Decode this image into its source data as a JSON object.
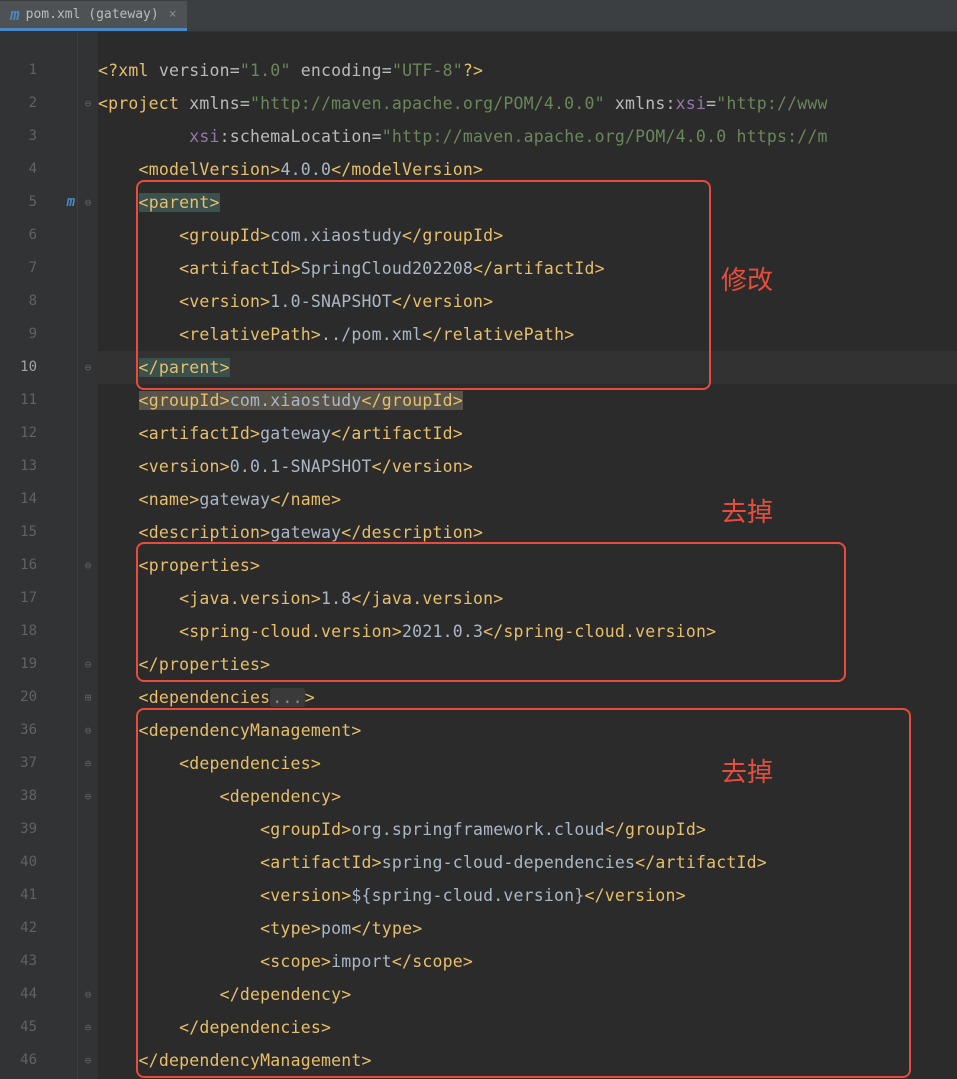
{
  "tab": {
    "icon": "m",
    "label": "pom.xml (gateway)",
    "close": "×"
  },
  "line_numbers": [
    "1",
    "2",
    "3",
    "4",
    "5",
    "6",
    "7",
    "8",
    "9",
    "10",
    "11",
    "12",
    "13",
    "14",
    "15",
    "16",
    "17",
    "18",
    "19",
    "20",
    "36",
    "37",
    "38",
    "39",
    "40",
    "41",
    "42",
    "43",
    "44",
    "45",
    "46"
  ],
  "current_line_index": 9,
  "maven_marker_line_index": 4,
  "fold_marks": [
    "",
    "⊖",
    "",
    "",
    "⊖",
    "",
    "",
    "",
    "",
    "⊖",
    "",
    "",
    "",
    "",
    "",
    "⊖",
    "",
    "",
    "⊖",
    "⊞",
    "⊖",
    "⊖",
    "⊖",
    "",
    "",
    "",
    "",
    "",
    "⊖",
    "⊖",
    "⊖"
  ],
  "code": {
    "l1": {
      "pi_open": "<?",
      "pi_name": "xml ",
      "a1": "version",
      "eq": "=",
      "v1": "\"1.0\"",
      "sp": " ",
      "a2": "encoding",
      "v2": "\"UTF-8\"",
      "pi_close": "?>"
    },
    "l2": {
      "o": "<",
      "tag": "project ",
      "a1": "xmlns",
      "eq": "=",
      "v1": "\"http://maven.apache.org/POM/4.0.0\"",
      "sp": " ",
      "a2": "xmlns:",
      "a2b": "xsi",
      "v2": "\"http://www"
    },
    "l3": {
      "a1": "xsi",
      "a1b": ":schemaLocation",
      "eq": "=",
      "v1": "\"http://maven.apache.org/POM/4.0.0 https://m"
    },
    "l4": {
      "o": "<",
      "t": "modelVersion",
      "c": ">",
      "txt": "4.0.0",
      "co": "</",
      "cc": ">"
    },
    "l5": {
      "o": "<",
      "t": "parent",
      "c": ">"
    },
    "l6": {
      "o": "<",
      "t": "groupId",
      "c": ">",
      "txt": "com.xiaostudy",
      "co": "</",
      "cc": ">"
    },
    "l7": {
      "o": "<",
      "t": "artifactId",
      "c": ">",
      "txt": "SpringCloud202208",
      "co": "</",
      "cc": ">"
    },
    "l8": {
      "o": "<",
      "t": "version",
      "c": ">",
      "txt": "1.0-SNAPSHOT",
      "co": "</",
      "cc": ">"
    },
    "l9": {
      "o": "<",
      "t": "relativePath",
      "c": ">",
      "txt": "../pom.xml",
      "co": "</",
      "cc": ">"
    },
    "l10": {
      "o": "</",
      "t": "parent",
      "c": ">"
    },
    "l11": {
      "o": "<",
      "t": "groupId",
      "c": ">",
      "txt": "com.xiaostudy",
      "co": "</",
      "cc": ">"
    },
    "l12": {
      "o": "<",
      "t": "artifactId",
      "c": ">",
      "txt": "gateway",
      "co": "</",
      "cc": ">"
    },
    "l13": {
      "o": "<",
      "t": "version",
      "c": ">",
      "txt": "0.0.1-SNAPSHOT",
      "co": "</",
      "cc": ">"
    },
    "l14": {
      "o": "<",
      "t": "name",
      "c": ">",
      "txt": "gateway",
      "co": "</",
      "cc": ">"
    },
    "l15": {
      "o": "<",
      "t": "description",
      "c": ">",
      "txt": "gateway",
      "co": "</",
      "cc": ">"
    },
    "l16": {
      "o": "<",
      "t": "properties",
      "c": ">"
    },
    "l17": {
      "o": "<",
      "t": "java.version",
      "c": ">",
      "txt": "1.8",
      "co": "</",
      "cc": ">"
    },
    "l18": {
      "o": "<",
      "t": "spring-cloud.version",
      "c": ">",
      "txt": "2021.0.3",
      "co": "</",
      "cc": ">"
    },
    "l19": {
      "o": "</",
      "t": "properties",
      "c": ">"
    },
    "l20": {
      "o": "<",
      "t": "dependencies",
      "fold": "...",
      "c": ">"
    },
    "l36": {
      "o": "<",
      "t": "dependencyManagement",
      "c": ">"
    },
    "l37": {
      "o": "<",
      "t": "dependencies",
      "c": ">"
    },
    "l38": {
      "o": "<",
      "t": "dependency",
      "c": ">"
    },
    "l39": {
      "o": "<",
      "t": "groupId",
      "c": ">",
      "txt": "org.springframework.cloud",
      "co": "</",
      "cc": ">"
    },
    "l40": {
      "o": "<",
      "t": "artifactId",
      "c": ">",
      "txt": "spring-cloud-dependencies",
      "co": "</",
      "cc": ">"
    },
    "l41": {
      "o": "<",
      "t": "version",
      "c": ">",
      "txt": "${spring-cloud.version}",
      "co": "</",
      "cc": ">"
    },
    "l42": {
      "o": "<",
      "t": "type",
      "c": ">",
      "txt": "pom",
      "co": "</",
      "cc": ">"
    },
    "l43": {
      "o": "<",
      "t": "scope",
      "c": ">",
      "txt": "import",
      "co": "</",
      "cc": ">"
    },
    "l44": {
      "o": "</",
      "t": "dependency",
      "c": ">"
    },
    "l45": {
      "o": "</",
      "t": "dependencies",
      "c": ">"
    },
    "l46": {
      "o": "</",
      "t": "dependencyManagement",
      "c": ">"
    }
  },
  "annotations": {
    "label1": "修改",
    "label2": "去掉",
    "label3": "去掉"
  }
}
